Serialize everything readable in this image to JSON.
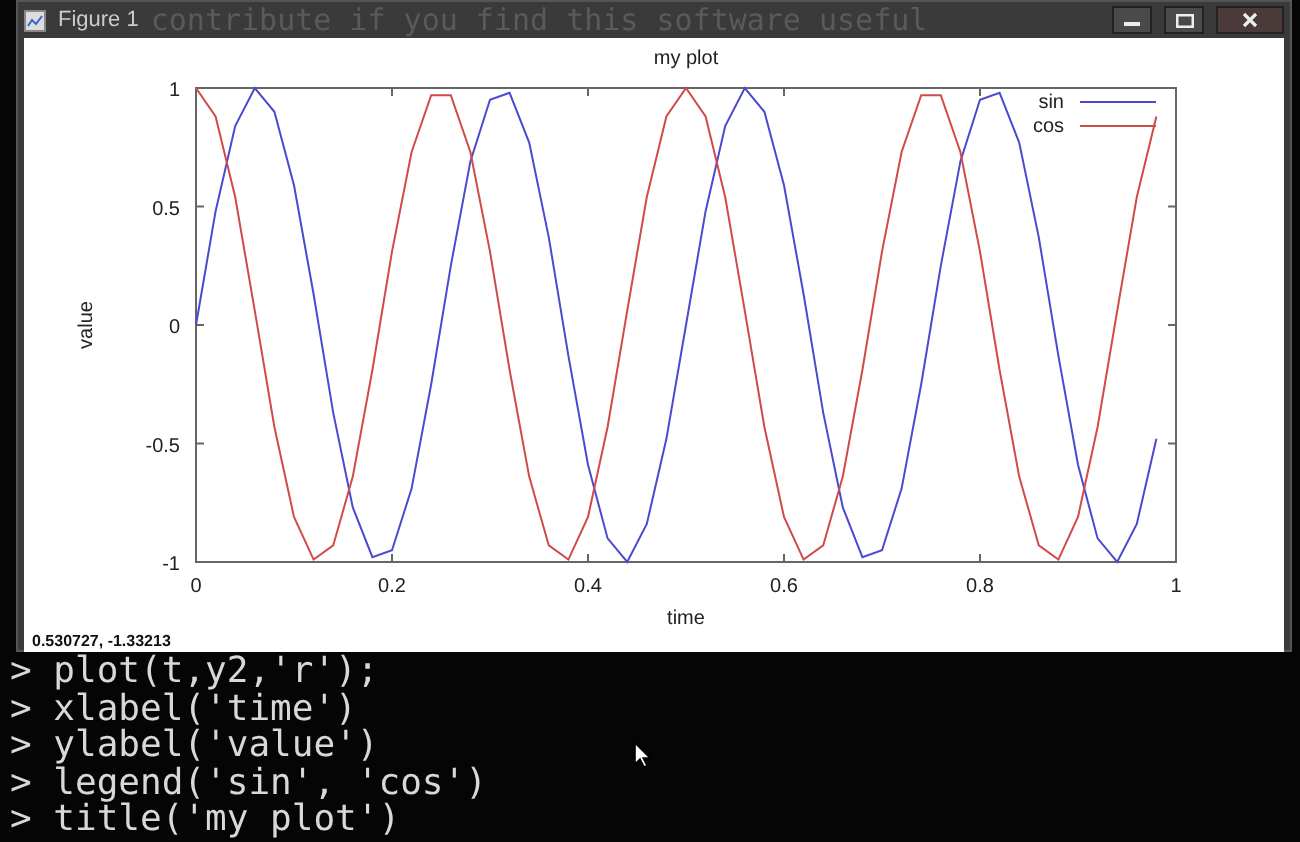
{
  "window": {
    "title": "Figure 1",
    "background_text": "contribute if you find this software useful"
  },
  "plot": {
    "chart_data": {
      "type": "line",
      "title": "my plot",
      "xlabel": "time",
      "ylabel": "value",
      "x": [
        0,
        0.02,
        0.04,
        0.06,
        0.08,
        0.1,
        0.12,
        0.14,
        0.16,
        0.18,
        0.2,
        0.22,
        0.24,
        0.26,
        0.28,
        0.3,
        0.32,
        0.34,
        0.36,
        0.38,
        0.4,
        0.42,
        0.44,
        0.46,
        0.48,
        0.5,
        0.52,
        0.54,
        0.56,
        0.58,
        0.6,
        0.62,
        0.64,
        0.66,
        0.68,
        0.7,
        0.72,
        0.74,
        0.76,
        0.78,
        0.8,
        0.82,
        0.84,
        0.86,
        0.88,
        0.9,
        0.92,
        0.94,
        0.96,
        0.98
      ],
      "series": [
        {
          "name": "sin",
          "color": "#4a4ad0",
          "values": [
            0,
            0.48,
            0.84,
            1,
            0.9,
            0.59,
            0.13,
            -0.37,
            -0.77,
            -0.98,
            -0.95,
            -0.69,
            -0.25,
            0.25,
            0.69,
            0.95,
            0.98,
            0.77,
            0.37,
            -0.13,
            -0.59,
            -0.9,
            -1,
            -0.84,
            -0.48,
            0,
            0.48,
            0.84,
            1,
            0.9,
            0.59,
            0.13,
            -0.37,
            -0.77,
            -0.98,
            -0.95,
            -0.69,
            -0.25,
            0.25,
            0.69,
            0.95,
            0.98,
            0.77,
            0.37,
            -0.13,
            -0.59,
            -0.9,
            -1,
            -0.84,
            -0.48
          ]
        },
        {
          "name": "cos",
          "color": "#d04a4a",
          "values": [
            1,
            0.88,
            0.54,
            0.06,
            -0.43,
            -0.81,
            -0.99,
            -0.93,
            -0.64,
            -0.19,
            0.31,
            0.73,
            0.97,
            0.97,
            0.73,
            0.31,
            -0.19,
            -0.64,
            -0.93,
            -0.99,
            -0.81,
            -0.43,
            0.06,
            0.54,
            0.88,
            1,
            0.88,
            0.54,
            0.06,
            -0.43,
            -0.81,
            -0.99,
            -0.93,
            -0.64,
            -0.19,
            0.31,
            0.73,
            0.97,
            0.97,
            0.73,
            0.31,
            -0.19,
            -0.64,
            -0.93,
            -0.99,
            -0.81,
            -0.43,
            0.06,
            0.54,
            0.88
          ]
        }
      ],
      "legend": true,
      "xlim": [
        0,
        1
      ],
      "ylim": [
        -1,
        1
      ],
      "xticks": [
        0,
        0.2,
        0.4,
        0.6,
        0.8,
        1
      ],
      "yticks": [
        -1,
        -0.5,
        0,
        0.5,
        1
      ]
    }
  },
  "status_bar": {
    "coordinates": "0.530727, -1.33213"
  },
  "terminal": {
    "lines": [
      "> plot(t,y2,'r');",
      "> xlabel('time')",
      "> ylabel('value')",
      "> legend('sin', 'cos')",
      "> title('my plot')"
    ]
  }
}
